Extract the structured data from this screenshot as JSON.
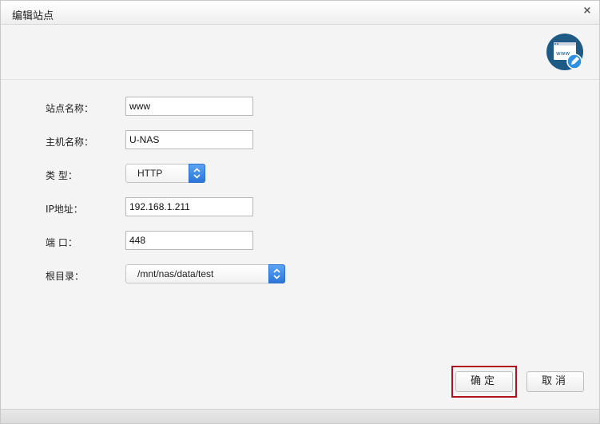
{
  "dialog": {
    "title": "编辑站点",
    "close_glyph": "×"
  },
  "banner": {
    "icon": "web-edit-icon",
    "icon_text": "www"
  },
  "form": {
    "site_name_label": "站点名称：",
    "site_name_value": "www",
    "host_name_label": "主机名称：",
    "host_name_value": "U-NAS",
    "type_label": "类 型：",
    "type_value": "HTTP",
    "ip_label": "IP地址：",
    "ip_value": "192.168.1.211",
    "port_label": "端 口：",
    "port_value": "448",
    "root_label": "根目录：",
    "root_value": "/mnt/nas/data/test"
  },
  "buttons": {
    "ok_label": "确定",
    "cancel_label": "取消"
  },
  "colors": {
    "accent": "#2d76d8",
    "highlight_border": "#b0141a",
    "icon_bg": "#1f5a85"
  }
}
